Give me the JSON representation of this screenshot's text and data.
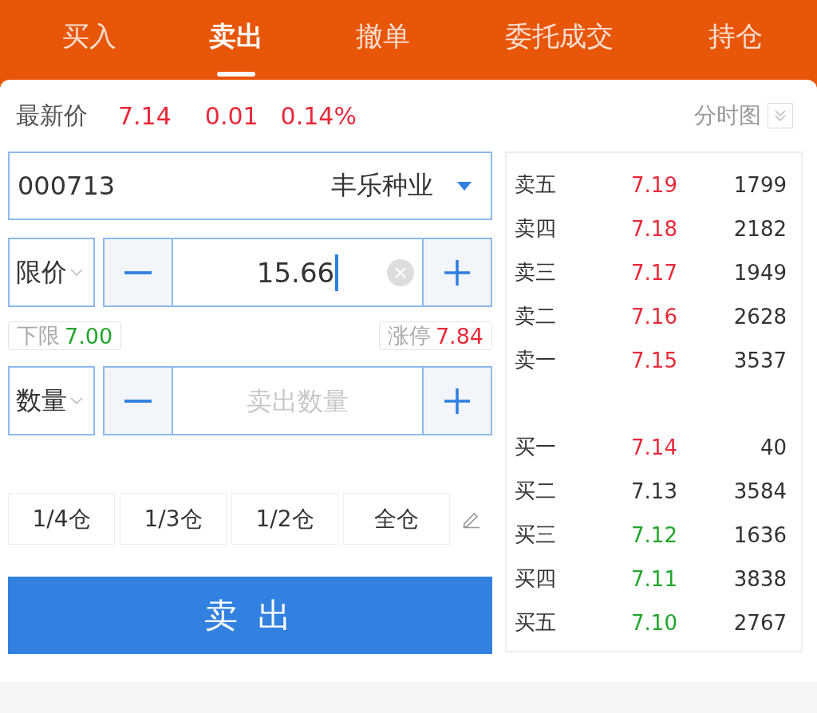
{
  "tabs": [
    {
      "label": "买入",
      "selected": false
    },
    {
      "label": "卖出",
      "selected": true
    },
    {
      "label": "撤单",
      "selected": false
    },
    {
      "label": "委托成交",
      "selected": false
    },
    {
      "label": "持仓",
      "selected": false
    }
  ],
  "quote": {
    "label": "最新价",
    "price": "7.14",
    "change": "0.01",
    "change_pct": "0.14%",
    "chart_toggle": "分时图"
  },
  "stock": {
    "code": "000713",
    "name": "丰乐种业"
  },
  "price": {
    "type_label": "限价",
    "value": "15.66"
  },
  "limits": {
    "lower": {
      "label": "下限",
      "value": "7.00"
    },
    "upper": {
      "label": "涨停",
      "value": "7.84"
    }
  },
  "quantity": {
    "type_label": "数量",
    "placeholder": "卖出数量"
  },
  "position_buttons": [
    "1/4仓",
    "1/3仓",
    "1/2仓",
    "全仓"
  ],
  "sell_button": "卖 出",
  "order_book": {
    "asks": [
      {
        "label": "卖五",
        "price": "7.19",
        "volume": "1799",
        "color": "#e8293a"
      },
      {
        "label": "卖四",
        "price": "7.18",
        "volume": "2182",
        "color": "#e8293a"
      },
      {
        "label": "卖三",
        "price": "7.17",
        "volume": "1949",
        "color": "#e8293a"
      },
      {
        "label": "卖二",
        "price": "7.16",
        "volume": "2628",
        "color": "#e8293a"
      },
      {
        "label": "卖一",
        "price": "7.15",
        "volume": "3537",
        "color": "#e8293a"
      }
    ],
    "bids": [
      {
        "label": "买一",
        "price": "7.14",
        "volume": "40",
        "color": "#e8293a"
      },
      {
        "label": "买二",
        "price": "7.13",
        "volume": "3584",
        "color": "#333333"
      },
      {
        "label": "买三",
        "price": "7.12",
        "volume": "1636",
        "color": "#22a52c"
      },
      {
        "label": "买四",
        "price": "7.11",
        "volume": "3838",
        "color": "#22a52c"
      },
      {
        "label": "买五",
        "price": "7.10",
        "volume": "2767",
        "color": "#22a52c"
      }
    ]
  }
}
